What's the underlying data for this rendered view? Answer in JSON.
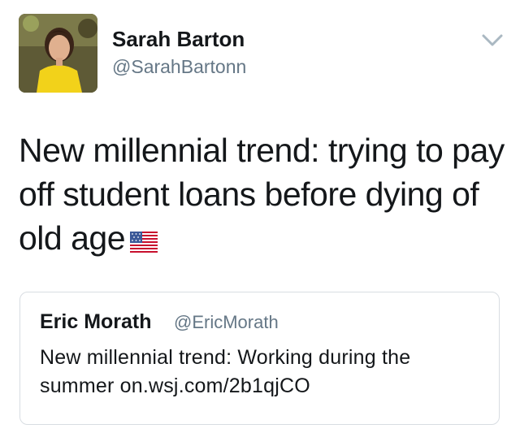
{
  "tweet": {
    "author": {
      "display_name": "Sarah Barton",
      "handle": "@SarahBartonn"
    },
    "text_lines": [
      "New millennial trend: trying to pay",
      "off student loans before dying of",
      "old age"
    ],
    "emoji": "flag-us",
    "menu_icon": "chevron-down-icon"
  },
  "quoted_tweet": {
    "author": {
      "display_name": "Eric Morath",
      "handle": "@EricMorath"
    },
    "text_lines": [
      "New millennial trend: Working during the",
      "summer on.wsj.com/2b1qjCO"
    ]
  },
  "colors": {
    "primary_text": "#14171a",
    "secondary_text": "#657786",
    "card_border": "#d8dde2"
  }
}
